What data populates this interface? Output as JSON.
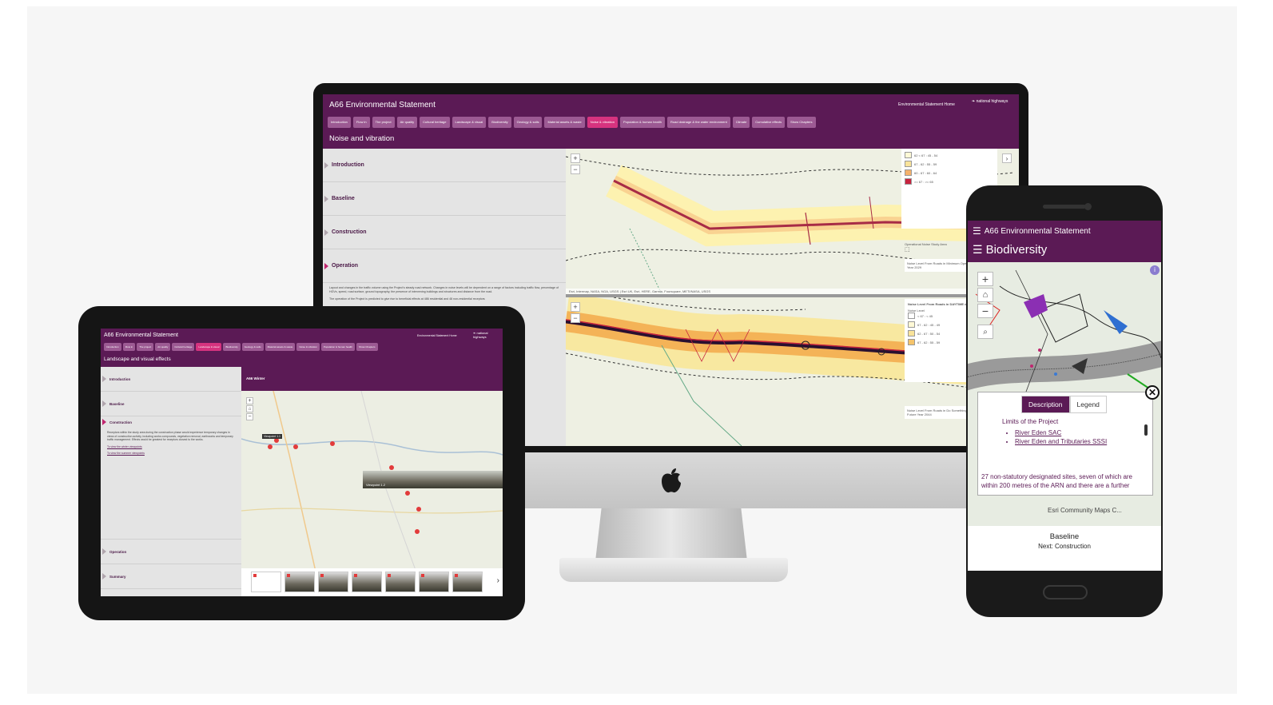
{
  "desktop": {
    "app_title": "A66 Environmental Statement",
    "home_link": "Environmental Statement Home",
    "brand": "national highways",
    "nav": [
      "Introduction",
      "Flow in",
      "The project",
      "Air quality",
      "Cultural heritage",
      "Landscape & visual",
      "Biodiversity",
      "Geology & soils",
      "Material assets & waste",
      "Noise & vibration",
      "Population & human health",
      "Road drainage & the water environment",
      "Climate",
      "Cumulative effects",
      "Show Chapters"
    ],
    "active_nav": "Noise & vibration",
    "page_title": "Noise and vibration",
    "sections": [
      "Introduction",
      "Baseline",
      "Construction",
      "Operation"
    ],
    "operation_text": "Layout and changes in the traffic volume using the Project's steady road network. Changes in noise levels will be dependent on a range of factors including traffic flow, percentage of HGVs, speed, road surface, ground topography, the presence of intervening buildings and structures and distance from the road.",
    "operation_text2": "The operation of the Project is predicted to give rise to beneficial effects at 486 residential and 48 non-residential receptors",
    "map_attribution": "Esri, Intermap, NASA, NGA, USGS | Esri UK, Esri, HERE, Garmin, Foursquare, METI/NASA, USGS",
    "legend_top": [
      "62 < 67 : 45 - 54",
      "67 - 62 : 55 - 59",
      "60 - 67 : 60 - 64",
      ">= 67 : >= 65"
    ],
    "legend_top_title": "Operational Noise Study Area",
    "legend_top_foot": "Noise Level From Roads in Minimum Opening Year 2029",
    "legend_bottom_title": "Noise Level From Roads in DAYTIME dB LpAeq,16h",
    "legend_bottom_sub": "Noise Level",
    "legend_bottom": [
      "< 67 : < 45",
      "67 - 62 : 45 - 49",
      "62 - 67 : 50 - 54",
      "67 - 62 : 55 - 59"
    ],
    "legend_bottom_foot": "Noise Level From Roads in Do Something Future Year 2044"
  },
  "tablet": {
    "app_title": "A66 Environmental Statement",
    "home_link": "Environmental Statement Home",
    "brand": "national highways",
    "nav": [
      "Introduction",
      "Flow in",
      "The project",
      "Air quality",
      "Cultural heritage",
      "Landscape & visual",
      "Biodiversity",
      "Geology & soils",
      "Material assets & waste",
      "Noise & vibration",
      "Population & human health",
      "Show Chapters"
    ],
    "active_nav": "Landscape & visual",
    "page_title": "Landscape and visual effects",
    "sections": [
      "Introduction",
      "Baseline",
      "Construction",
      "Operation",
      "Summary"
    ],
    "map_title": "A66 Winter",
    "viewpoint_label": "Viewpoint 1.2",
    "viewpoint_tag": "Viewpoint 1.1",
    "links": [
      "To view the winter viewpoints",
      "To view the summer viewpoints"
    ],
    "construction_text": "Receptors within the study area during the construction phase would experience temporary changes in views of construction activity, including works compounds, vegetation removal, earthworks and temporary traffic management. Effects would be greatest for receptors closest to the works."
  },
  "phone": {
    "app_title": "A66 Environmental Statement",
    "page_title": "Biodiversity",
    "tabs": [
      "Description",
      "Legend"
    ],
    "active_tab": "Description",
    "popup_heading": "Limits of the Project",
    "popup_items": [
      "River Eden SAC",
      "River Eden and Tributaries SSSI"
    ],
    "popup_text": "27 non-statutory designated sites, seven of which are within 200 metres of the ARN and there are a further",
    "attribution": "Esri Community Maps C...",
    "section_label": "Baseline",
    "next_label": "Next: Construction"
  },
  "colors": {
    "brand": "#5b1a55",
    "pill": "#9c5a93",
    "active": "#d6337f"
  }
}
